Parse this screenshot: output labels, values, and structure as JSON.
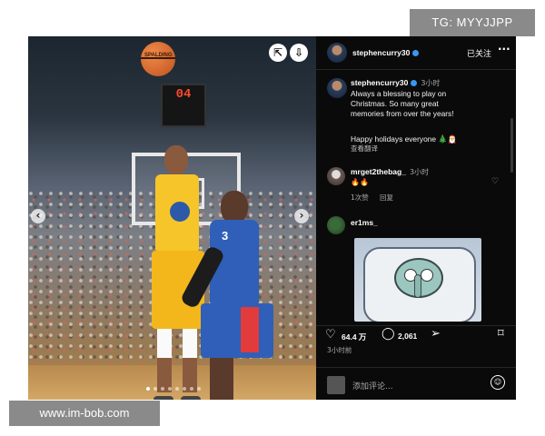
{
  "watermark_top": "TG: MYYJJPP",
  "watermark_bottom": "www.im-bob.com",
  "photo": {
    "shot_clock": "04",
    "ball_text": "SPALDING",
    "jersey_number": "3",
    "carousel_dots": 8,
    "active_dot": 0,
    "prev_arrow": "‹",
    "next_arrow": "›",
    "share_icon": "⇱",
    "download_icon": "⇩"
  },
  "post": {
    "username": "stephencurry30",
    "follow_label": "已关注",
    "more_label": "···",
    "caption": {
      "username": "stephencurry30",
      "time": "3小时",
      "line1": "Always a blessing to play on",
      "line2": "Christmas. So many great",
      "line3": "memories from over the years!",
      "line4": "Happy holidays everyone 🎄🎅",
      "translate": "查看翻译"
    },
    "comments": [
      {
        "username": "mrget2thebag_",
        "time": "3小时",
        "text": "🔥🔥",
        "likes": "1次赞",
        "reply": "回复"
      },
      {
        "username": "er1ms_",
        "time": "",
        "text": "",
        "likes": "",
        "reply": ""
      }
    ],
    "likes": "64.4 万",
    "comments_count": "2,061",
    "posted_time": "3小时前",
    "comment_placeholder": "添加评论..."
  }
}
